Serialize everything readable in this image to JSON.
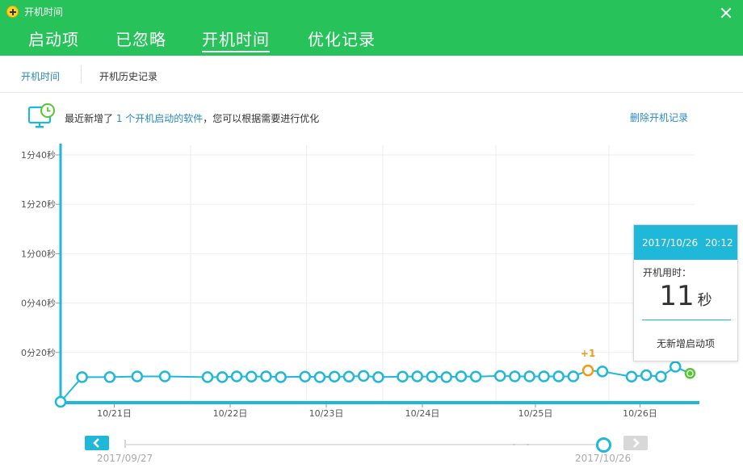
{
  "window": {
    "title": "开机时间",
    "logo": "wheel-cross-logo",
    "close_icon": "close-icon"
  },
  "main_tabs": [
    {
      "label": "启动项",
      "active": false
    },
    {
      "label": "已忽略",
      "active": false
    },
    {
      "label": "开机时间",
      "active": true
    },
    {
      "label": "优化记录",
      "active": false
    }
  ],
  "sub_tabs": [
    {
      "label": "开机时间",
      "active": true
    },
    {
      "label": "开机历史记录",
      "active": false
    }
  ],
  "notice": {
    "icon": "monitor-clock-icon",
    "prefix": "最近新增了 ",
    "link": "1 个开机启动的软件",
    "suffix": "，您可以根据需要进行优化"
  },
  "delete_link": "删除开机记录",
  "chart_data": {
    "type": "line",
    "y_unit": "seconds",
    "ylim": [
      0,
      100
    ],
    "y_ticks": [
      {
        "value": 20,
        "label": "0分20秒"
      },
      {
        "value": 40,
        "label": "0分40秒"
      },
      {
        "value": 60,
        "label": "1分00秒"
      },
      {
        "value": 80,
        "label": "1分20秒"
      },
      {
        "value": 100,
        "label": "1分40秒"
      }
    ],
    "x_ticks": [
      {
        "index": 1.9,
        "label": "10/21日"
      },
      {
        "index": 6.0,
        "label": "10/22日"
      },
      {
        "index": 9.4,
        "label": "10/23日"
      },
      {
        "index": 12.8,
        "label": "10/24日"
      },
      {
        "index": 16.8,
        "label": "10/25日"
      },
      {
        "index": 20.5,
        "label": "10/26日"
      }
    ],
    "vertical_gridlines": [
      4.6,
      8.7,
      11.4,
      15.4,
      19.4
    ],
    "x_max": 22.2,
    "points": [
      {
        "index": 0,
        "value": 0
      },
      {
        "index": 0.76,
        "value": 10
      },
      {
        "index": 1.74,
        "value": 10
      },
      {
        "index": 2.71,
        "value": 10.3
      },
      {
        "index": 3.69,
        "value": 10.3
      },
      {
        "index": 5.2,
        "value": 10
      },
      {
        "index": 5.72,
        "value": 10
      },
      {
        "index": 6.23,
        "value": 10.3
      },
      {
        "index": 6.75,
        "value": 10.2
      },
      {
        "index": 7.27,
        "value": 10.3
      },
      {
        "index": 7.79,
        "value": 10
      },
      {
        "index": 8.65,
        "value": 10.2
      },
      {
        "index": 9.17,
        "value": 10
      },
      {
        "index": 9.69,
        "value": 10.2
      },
      {
        "index": 10.2,
        "value": 10.2
      },
      {
        "index": 10.72,
        "value": 10.5
      },
      {
        "index": 11.24,
        "value": 10
      },
      {
        "index": 12.1,
        "value": 10.2
      },
      {
        "index": 12.62,
        "value": 10.3
      },
      {
        "index": 13.14,
        "value": 10.2
      },
      {
        "index": 13.65,
        "value": 10
      },
      {
        "index": 14.17,
        "value": 10.3
      },
      {
        "index": 14.69,
        "value": 10.2
      },
      {
        "index": 15.55,
        "value": 10.5
      },
      {
        "index": 16.07,
        "value": 10.3
      },
      {
        "index": 16.59,
        "value": 10.3
      },
      {
        "index": 17.1,
        "value": 10.3
      },
      {
        "index": 17.62,
        "value": 10.3
      },
      {
        "index": 18.14,
        "value": 10.3
      },
      {
        "index": 18.66,
        "value": 12.7,
        "highlight": "new",
        "label": "+1"
      },
      {
        "index": 19.17,
        "value": 12.3
      },
      {
        "index": 20.2,
        "value": 10.2
      },
      {
        "index": 20.72,
        "value": 10.8
      },
      {
        "index": 21.24,
        "value": 10.2
      },
      {
        "index": 21.75,
        "value": 14.2
      },
      {
        "index": 22.27,
        "value": 11.5,
        "highlight": "selected"
      }
    ],
    "colors": {
      "line": "#1fb8d8",
      "new_point": "#f39a13",
      "selected_point": "#58c634",
      "grid": "#eeeeee"
    }
  },
  "tooltip": {
    "date": "2017/10/26",
    "time": "20:12",
    "label": "开机用时：",
    "value": "11",
    "unit": "秒",
    "note": "无新增启动项"
  },
  "timeline": {
    "start_date": "2017/09/27",
    "end_date": "2017/10/26",
    "prev_icon": "chevron-left-icon",
    "next_icon": "chevron-right-icon"
  },
  "colors": {
    "header_bg": "#27c35a",
    "accent": "#1fb8d8",
    "link": "#2a89c6"
  }
}
